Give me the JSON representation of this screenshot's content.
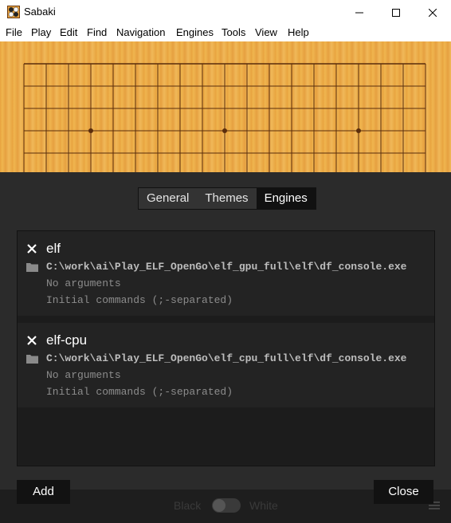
{
  "window": {
    "title": "Sabaki"
  },
  "menubar": {
    "items": [
      "File",
      "Play",
      "Edit",
      "Find",
      "Navigation",
      "Engines",
      "Tools",
      "View",
      "Help"
    ]
  },
  "preferences": {
    "tabs": [
      "General",
      "Themes",
      "Engines"
    ],
    "active_tab": "Engines",
    "engines": [
      {
        "name": "elf",
        "path": "C:\\work\\ai\\Play_ELF_OpenGo\\elf_gpu_full\\elf\\df_console.exe",
        "arguments_placeholder": "No arguments",
        "commands_placeholder": "Initial commands (;-separated)"
      },
      {
        "name": "elf-cpu",
        "path": "C:\\work\\ai\\Play_ELF_OpenGo\\elf_cpu_full\\elf\\df_console.exe",
        "arguments_placeholder": "No arguments",
        "commands_placeholder": "Initial commands (;-separated)"
      }
    ],
    "add_label": "Add",
    "close_label": "Close"
  },
  "player_bar": {
    "black_label": "Black",
    "white_label": "White"
  },
  "colors": {
    "board": "#efb54f",
    "board_line": "#5a2d0c",
    "overlay": "#2b2b2b",
    "active_tab": "#111111"
  }
}
